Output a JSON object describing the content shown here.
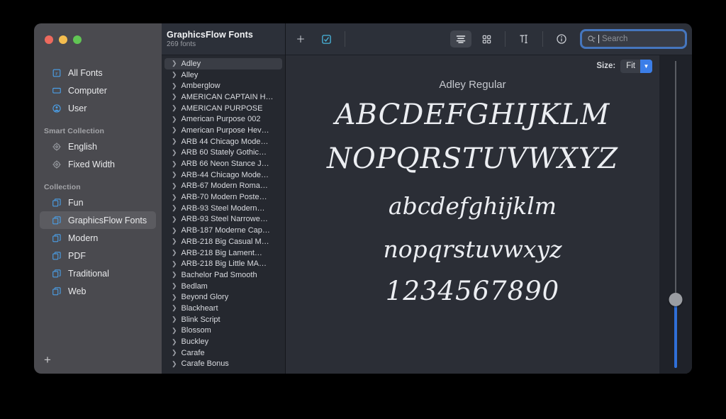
{
  "window": {
    "traffic_lights": [
      {
        "name": "close",
        "color": "#ed6a5e"
      },
      {
        "name": "minimize",
        "color": "#f4bd4f"
      },
      {
        "name": "zoom",
        "color": "#61c554"
      }
    ]
  },
  "sidebar": {
    "sections": [
      {
        "header": null,
        "items": [
          {
            "label": "All Fonts",
            "icon": "all-fonts-icon",
            "selected": false
          },
          {
            "label": "Computer",
            "icon": "computer-icon",
            "selected": false
          },
          {
            "label": "User",
            "icon": "user-icon",
            "selected": false
          }
        ]
      },
      {
        "header": "Smart Collection",
        "items": [
          {
            "label": "English",
            "icon": "gear-icon",
            "selected": false
          },
          {
            "label": "Fixed Width",
            "icon": "gear-icon",
            "selected": false
          }
        ]
      },
      {
        "header": "Collection",
        "items": [
          {
            "label": "Fun",
            "icon": "collection-icon",
            "selected": false
          },
          {
            "label": "GraphicsFlow Fonts",
            "icon": "collection-icon",
            "selected": true
          },
          {
            "label": "Modern",
            "icon": "collection-icon",
            "selected": false
          },
          {
            "label": "PDF",
            "icon": "collection-icon",
            "selected": false
          },
          {
            "label": "Traditional",
            "icon": "collection-icon",
            "selected": false
          },
          {
            "label": "Web",
            "icon": "collection-icon",
            "selected": false
          }
        ]
      }
    ],
    "add_button": "+"
  },
  "list_header": {
    "title": "GraphicsFlow Fonts",
    "subtitle": "269 fonts"
  },
  "toolbar": {
    "add_label": "+",
    "add_icon": "plus-icon",
    "validate_icon": "checkbox-icon",
    "view_sample_icon": "sample-view-icon",
    "view_grid_icon": "grid-view-icon",
    "view_text_icon": "text-cursor-icon",
    "info_icon": "info-icon",
    "search": {
      "icon": "search-icon",
      "placeholder": "Search",
      "value": ""
    }
  },
  "font_list": [
    {
      "name": "Adley",
      "selected": true
    },
    {
      "name": "Alley",
      "selected": false
    },
    {
      "name": "Amberglow",
      "selected": false
    },
    {
      "name": "AMERICAN CAPTAIN H…",
      "selected": false
    },
    {
      "name": "AMERICAN PURPOSE",
      "selected": false
    },
    {
      "name": "American Purpose 002",
      "selected": false
    },
    {
      "name": "American Purpose Hev…",
      "selected": false
    },
    {
      "name": "ARB 44 Chicago Mode…",
      "selected": false
    },
    {
      "name": "ARB 60 Stately Gothic…",
      "selected": false
    },
    {
      "name": "ARB 66 Neon Stance J…",
      "selected": false
    },
    {
      "name": "ARB-44 Chicago Mode…",
      "selected": false
    },
    {
      "name": "ARB-67 Modern Roma…",
      "selected": false
    },
    {
      "name": "ARB-70 Modern Poste…",
      "selected": false
    },
    {
      "name": "ARB-93 Steel Modern…",
      "selected": false
    },
    {
      "name": "ARB-93 Steel Narrowe…",
      "selected": false
    },
    {
      "name": "ARB-187 Moderne Cap…",
      "selected": false
    },
    {
      "name": "ARB-218 Big Casual M…",
      "selected": false
    },
    {
      "name": "ARB-218 Big Lament…",
      "selected": false
    },
    {
      "name": "ARB-218 Big Little MA…",
      "selected": false
    },
    {
      "name": "Bachelor Pad Smooth",
      "selected": false
    },
    {
      "name": "Bedlam",
      "selected": false
    },
    {
      "name": "Beyond Glory",
      "selected": false
    },
    {
      "name": "Blackheart",
      "selected": false
    },
    {
      "name": "Blink Script",
      "selected": false
    },
    {
      "name": "Blossom",
      "selected": false
    },
    {
      "name": "Buckley",
      "selected": false
    },
    {
      "name": "Carafe",
      "selected": false
    },
    {
      "name": "Carafe Bonus",
      "selected": false
    }
  ],
  "preview": {
    "size_label": "Size:",
    "size_value": "Fit",
    "font_title": "Adley Regular",
    "rows": [
      "ABCDEFGHIJKLM",
      "NOPQRSTUVWXYZ",
      "abcdefghijklm",
      "nopqrstuvwxyz",
      "1234567890"
    ],
    "slider": {
      "knob_position_percent": 80
    }
  },
  "colors": {
    "accent": "#3b7ee8",
    "sidebar_bg": "#4a4a4f",
    "list_bg": "#25282f",
    "preview_bg": "#2b2e36",
    "icon_blue": "#4a9fe8"
  }
}
